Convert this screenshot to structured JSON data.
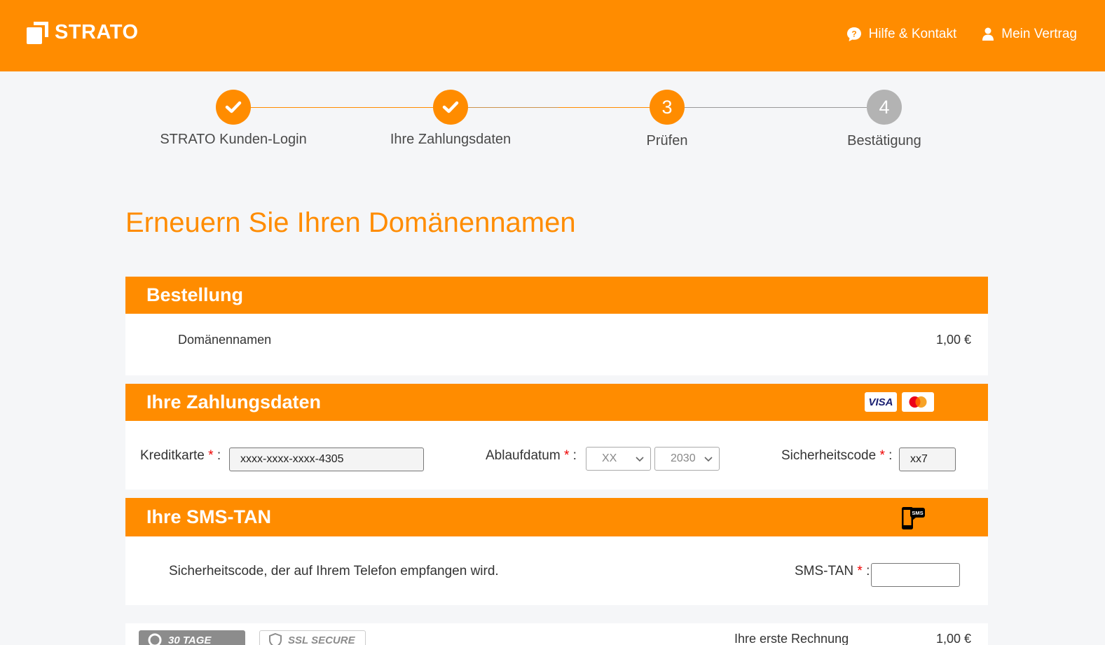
{
  "header": {
    "brand": "STRATO",
    "help_label": "Hilfe & Kontakt",
    "contract_label": "Mein Vertrag"
  },
  "steps": [
    {
      "label": "STRATO Kunden-Login",
      "state": "done",
      "number": "1"
    },
    {
      "label": "Ihre Zahlungsdaten",
      "state": "done",
      "number": "2"
    },
    {
      "label": "Prüfen",
      "state": "current",
      "number": "3"
    },
    {
      "label": "Bestätigung",
      "state": "pending",
      "number": "4"
    }
  ],
  "page_title": "Erneuern Sie Ihren Domänennamen",
  "order": {
    "heading": "Bestellung",
    "item_label": "Domänennamen",
    "item_price": "1,00 €"
  },
  "payment": {
    "heading": "Ihre Zahlungsdaten",
    "visa_label": "VISA",
    "card_label": "Kreditkarte",
    "card_value": "xxxx-xxxx-xxxx-4305",
    "expiry_label": "Ablaufdatum",
    "expiry_month": "XX",
    "expiry_year": "2030",
    "cvc_label": "Sicherheitscode",
    "cvc_value": "xx7",
    "required_mark": "*",
    "colon": ":"
  },
  "sms": {
    "heading": "Ihre SMS-TAN",
    "sms_icon_text": "SMS",
    "description": "Sicherheitscode, der auf Ihrem Telefon empfangen wird.",
    "tan_label": "SMS-TAN",
    "tan_value": ""
  },
  "footer": {
    "badge_days": "30 TAGE",
    "badge_ssl": "SSL SECURE",
    "first_invoice_label": "Ihre erste Rechnung",
    "first_invoice_price": "1,00 €"
  },
  "colors": {
    "brand_orange": "#ff8c00",
    "required_red": "#e00000",
    "step_grey": "#b3b3b3"
  }
}
